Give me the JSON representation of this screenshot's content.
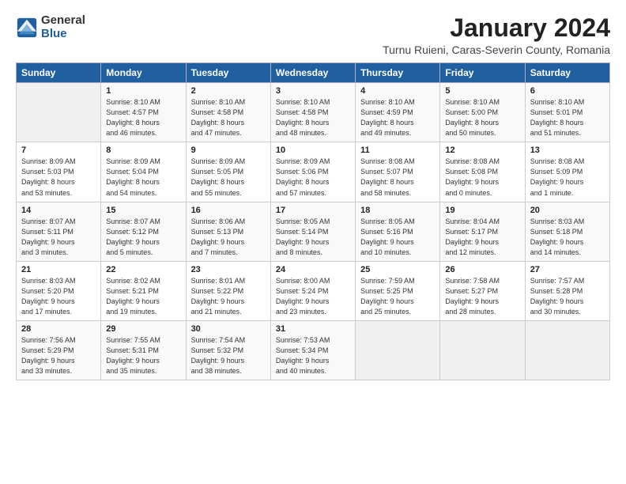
{
  "header": {
    "logo_general": "General",
    "logo_blue": "Blue",
    "month": "January 2024",
    "location": "Turnu Ruieni, Caras-Severin County, Romania"
  },
  "days_of_week": [
    "Sunday",
    "Monday",
    "Tuesday",
    "Wednesday",
    "Thursday",
    "Friday",
    "Saturday"
  ],
  "weeks": [
    [
      {
        "day": "",
        "info": ""
      },
      {
        "day": "1",
        "info": "Sunrise: 8:10 AM\nSunset: 4:57 PM\nDaylight: 8 hours\nand 46 minutes."
      },
      {
        "day": "2",
        "info": "Sunrise: 8:10 AM\nSunset: 4:58 PM\nDaylight: 8 hours\nand 47 minutes."
      },
      {
        "day": "3",
        "info": "Sunrise: 8:10 AM\nSunset: 4:58 PM\nDaylight: 8 hours\nand 48 minutes."
      },
      {
        "day": "4",
        "info": "Sunrise: 8:10 AM\nSunset: 4:59 PM\nDaylight: 8 hours\nand 49 minutes."
      },
      {
        "day": "5",
        "info": "Sunrise: 8:10 AM\nSunset: 5:00 PM\nDaylight: 8 hours\nand 50 minutes."
      },
      {
        "day": "6",
        "info": "Sunrise: 8:10 AM\nSunset: 5:01 PM\nDaylight: 8 hours\nand 51 minutes."
      }
    ],
    [
      {
        "day": "7",
        "info": "Sunrise: 8:09 AM\nSunset: 5:03 PM\nDaylight: 8 hours\nand 53 minutes."
      },
      {
        "day": "8",
        "info": "Sunrise: 8:09 AM\nSunset: 5:04 PM\nDaylight: 8 hours\nand 54 minutes."
      },
      {
        "day": "9",
        "info": "Sunrise: 8:09 AM\nSunset: 5:05 PM\nDaylight: 8 hours\nand 55 minutes."
      },
      {
        "day": "10",
        "info": "Sunrise: 8:09 AM\nSunset: 5:06 PM\nDaylight: 8 hours\nand 57 minutes."
      },
      {
        "day": "11",
        "info": "Sunrise: 8:08 AM\nSunset: 5:07 PM\nDaylight: 8 hours\nand 58 minutes."
      },
      {
        "day": "12",
        "info": "Sunrise: 8:08 AM\nSunset: 5:08 PM\nDaylight: 9 hours\nand 0 minutes."
      },
      {
        "day": "13",
        "info": "Sunrise: 8:08 AM\nSunset: 5:09 PM\nDaylight: 9 hours\nand 1 minute."
      }
    ],
    [
      {
        "day": "14",
        "info": "Sunrise: 8:07 AM\nSunset: 5:11 PM\nDaylight: 9 hours\nand 3 minutes."
      },
      {
        "day": "15",
        "info": "Sunrise: 8:07 AM\nSunset: 5:12 PM\nDaylight: 9 hours\nand 5 minutes."
      },
      {
        "day": "16",
        "info": "Sunrise: 8:06 AM\nSunset: 5:13 PM\nDaylight: 9 hours\nand 7 minutes."
      },
      {
        "day": "17",
        "info": "Sunrise: 8:05 AM\nSunset: 5:14 PM\nDaylight: 9 hours\nand 8 minutes."
      },
      {
        "day": "18",
        "info": "Sunrise: 8:05 AM\nSunset: 5:16 PM\nDaylight: 9 hours\nand 10 minutes."
      },
      {
        "day": "19",
        "info": "Sunrise: 8:04 AM\nSunset: 5:17 PM\nDaylight: 9 hours\nand 12 minutes."
      },
      {
        "day": "20",
        "info": "Sunrise: 8:03 AM\nSunset: 5:18 PM\nDaylight: 9 hours\nand 14 minutes."
      }
    ],
    [
      {
        "day": "21",
        "info": "Sunrise: 8:03 AM\nSunset: 5:20 PM\nDaylight: 9 hours\nand 17 minutes."
      },
      {
        "day": "22",
        "info": "Sunrise: 8:02 AM\nSunset: 5:21 PM\nDaylight: 9 hours\nand 19 minutes."
      },
      {
        "day": "23",
        "info": "Sunrise: 8:01 AM\nSunset: 5:22 PM\nDaylight: 9 hours\nand 21 minutes."
      },
      {
        "day": "24",
        "info": "Sunrise: 8:00 AM\nSunset: 5:24 PM\nDaylight: 9 hours\nand 23 minutes."
      },
      {
        "day": "25",
        "info": "Sunrise: 7:59 AM\nSunset: 5:25 PM\nDaylight: 9 hours\nand 25 minutes."
      },
      {
        "day": "26",
        "info": "Sunrise: 7:58 AM\nSunset: 5:27 PM\nDaylight: 9 hours\nand 28 minutes."
      },
      {
        "day": "27",
        "info": "Sunrise: 7:57 AM\nSunset: 5:28 PM\nDaylight: 9 hours\nand 30 minutes."
      }
    ],
    [
      {
        "day": "28",
        "info": "Sunrise: 7:56 AM\nSunset: 5:29 PM\nDaylight: 9 hours\nand 33 minutes."
      },
      {
        "day": "29",
        "info": "Sunrise: 7:55 AM\nSunset: 5:31 PM\nDaylight: 9 hours\nand 35 minutes."
      },
      {
        "day": "30",
        "info": "Sunrise: 7:54 AM\nSunset: 5:32 PM\nDaylight: 9 hours\nand 38 minutes."
      },
      {
        "day": "31",
        "info": "Sunrise: 7:53 AM\nSunset: 5:34 PM\nDaylight: 9 hours\nand 40 minutes."
      },
      {
        "day": "",
        "info": ""
      },
      {
        "day": "",
        "info": ""
      },
      {
        "day": "",
        "info": ""
      }
    ]
  ]
}
